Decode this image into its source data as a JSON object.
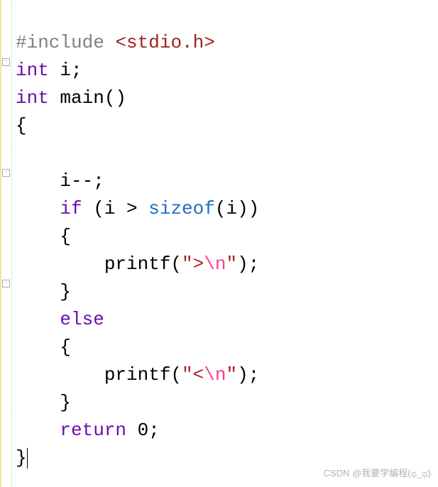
{
  "code": {
    "include_directive": "#include",
    "header": "<stdio.h>",
    "int_kw1": "int",
    "i_decl": " i;",
    "int_kw2": "int",
    "main_decl": " main()",
    "brace_open1": "{",
    "blank": "",
    "i_decrement": "    i--;",
    "if_kw": "    if",
    "if_cond_open": " (i > ",
    "sizeof_kw": "sizeof",
    "if_cond_close": "(i))",
    "brace_open2": "    {",
    "printf1_pre": "        printf(",
    "printf1_q1": "\"",
    "printf1_txt": ">",
    "printf1_esc": "\\n",
    "printf1_q2": "\"",
    "printf1_post": ");",
    "brace_close2": "    }",
    "else_kw": "    else",
    "brace_open3": "    {",
    "printf2_pre": "        printf(",
    "printf2_q1": "\"",
    "printf2_txt": "<",
    "printf2_esc": "\\n",
    "printf2_q2": "\"",
    "printf2_post": ");",
    "brace_close3": "    }",
    "return_kw": "    return",
    "return_val": " 0;",
    "brace_close1": "}"
  },
  "watermark": "CSDN @我要学编程(ಥ_ಥ)",
  "fold_marks": {
    "m1": "-",
    "m2": "-",
    "m3": "-"
  }
}
